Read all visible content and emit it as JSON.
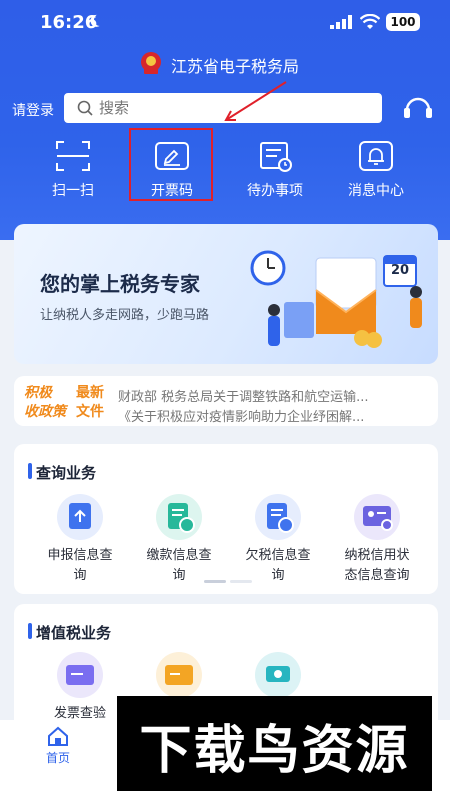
{
  "status_bar": {
    "time": "16:26",
    "battery": "100"
  },
  "header": {
    "app_title": "江苏省电子税务局",
    "login_label": "请登录"
  },
  "search": {
    "placeholder": "搜索"
  },
  "quick_actions": [
    {
      "label": "扫一扫",
      "icon": "scan-icon"
    },
    {
      "label": "开票码",
      "icon": "invoice-code-icon"
    },
    {
      "label": "待办事项",
      "icon": "todo-icon"
    },
    {
      "label": "消息中心",
      "icon": "bell-icon"
    }
  ],
  "banner": {
    "title": "您的掌上税务专家",
    "subtitle": "让纳税人多走网路，少跑马路",
    "calendar_number": "20"
  },
  "news": {
    "tag_left": [
      "积极",
      "收政策"
    ],
    "tag_right": [
      "最新",
      "文件"
    ],
    "items": [
      "财政部 税务总局关于调整铁路和航空运输...",
      "《关于积极应对疫情影响助力企业纾困解..."
    ]
  },
  "query_section": {
    "title": "查询业务",
    "items": [
      {
        "label_line1": "申报信息查",
        "label_line2": "询",
        "icon": "upload-doc-icon"
      },
      {
        "label_line1": "缴款信息查",
        "label_line2": "询",
        "icon": "payment-doc-icon"
      },
      {
        "label_line1": "欠税信息查",
        "label_line2": "询",
        "icon": "arrears-doc-icon"
      },
      {
        "label_line1": "纳税信用状",
        "label_line2": "态信息查询",
        "icon": "credit-card-icon"
      }
    ]
  },
  "vat_section": {
    "title": "增值税业务",
    "items": [
      {
        "label": "发票查验",
        "icon": "invoice-check-icon"
      },
      {
        "label": "",
        "icon": "invoice-ticket-icon"
      },
      {
        "label": "",
        "icon": "ticket-icon"
      }
    ]
  },
  "tabbar": {
    "home_label": "首页"
  },
  "watermark": {
    "text": "下载鸟资源"
  },
  "colors": {
    "primary": "#2f63ea",
    "highlight": "#e0202a",
    "accent_orange": "#f08a1c"
  }
}
